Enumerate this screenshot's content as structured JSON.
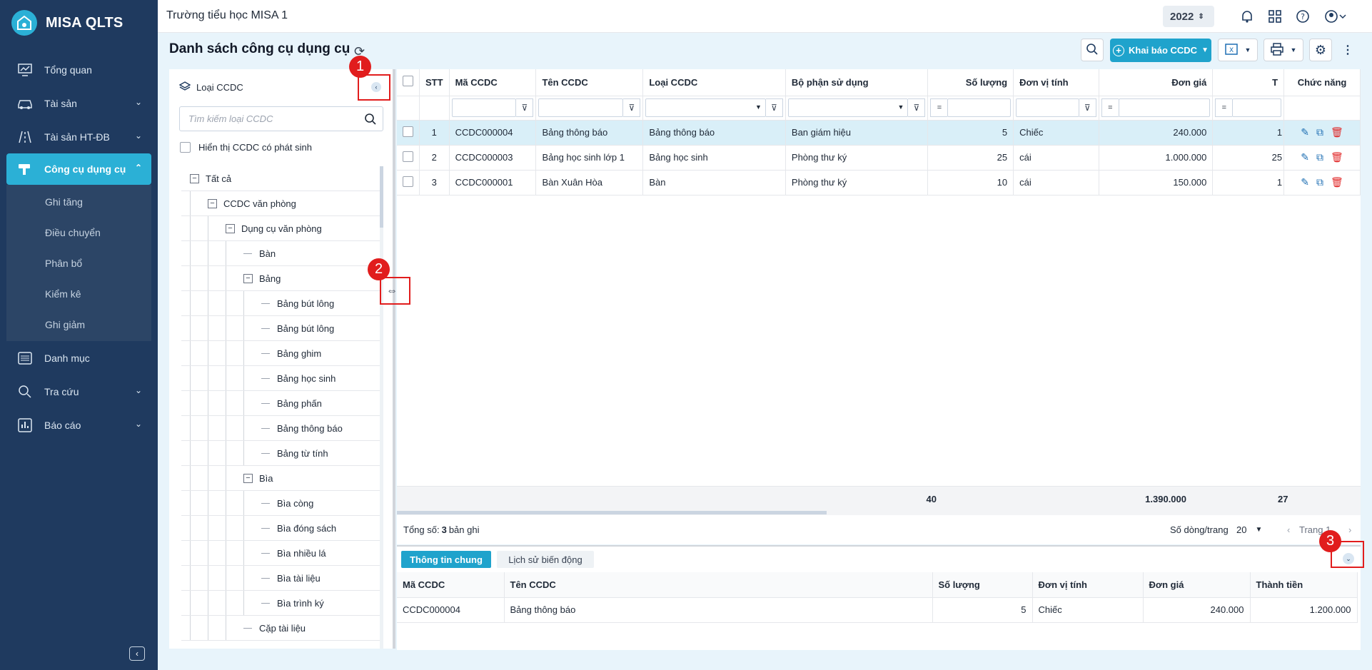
{
  "app": {
    "brand": "MISA QLTS",
    "school": "Trường tiểu học MISA 1",
    "year": "2022"
  },
  "sidebar": {
    "items": [
      {
        "label": "Tổng quan",
        "icon": "dashboard-icon"
      },
      {
        "label": "Tài sản",
        "icon": "car-icon",
        "has_chevron": true
      },
      {
        "label": "Tài sản HT-ĐB",
        "icon": "road-icon",
        "has_chevron": true
      },
      {
        "label": "Công cụ dụng cụ",
        "icon": "tools-icon",
        "has_chevron": true,
        "active": true
      },
      {
        "label": "Danh mục",
        "icon": "list-icon"
      },
      {
        "label": "Tra cứu",
        "icon": "search-icon",
        "has_chevron": true
      },
      {
        "label": "Báo cáo",
        "icon": "chart-icon",
        "has_chevron": true
      }
    ],
    "submenu": [
      "Ghi tăng",
      "Điều chuyển",
      "Phân bổ",
      "Kiểm kê",
      "Ghi giảm"
    ]
  },
  "page": {
    "title": "Danh sách công cụ dụng cụ",
    "add_button": "Khai báo CCDC"
  },
  "tree": {
    "title": "Loại CCDC",
    "search_placeholder": "Tìm kiếm loại CCDC",
    "show_arising": "Hiển thị CCDC có phát sinh",
    "nodes": [
      {
        "label": "Tất cả",
        "level": 0,
        "toggle": "⊟"
      },
      {
        "label": "CCDC văn phòng",
        "level": 1,
        "toggle": "⊟"
      },
      {
        "label": "Dụng cụ văn phòng",
        "level": 2,
        "toggle": "⊟"
      },
      {
        "label": "Bàn",
        "level": 3
      },
      {
        "label": "Bảng",
        "level": 3,
        "toggle": "⊟"
      },
      {
        "label": "Bảng bút lông",
        "level": 4
      },
      {
        "label": "Bảng bút lông",
        "level": 4
      },
      {
        "label": "Bảng ghim",
        "level": 4
      },
      {
        "label": "Bảng học sinh",
        "level": 4
      },
      {
        "label": "Bảng phấn",
        "level": 4
      },
      {
        "label": "Bảng thông báo",
        "level": 4
      },
      {
        "label": "Bảng từ tính",
        "level": 4
      },
      {
        "label": "Bìa",
        "level": 3,
        "toggle": "⊟"
      },
      {
        "label": "Bìa còng",
        "level": 4
      },
      {
        "label": "Bìa đóng sách",
        "level": 4
      },
      {
        "label": "Bìa nhiều lá",
        "level": 4
      },
      {
        "label": "Bìa tài liệu",
        "level": 4
      },
      {
        "label": "Bìa trình ký",
        "level": 4
      },
      {
        "label": "Cặp tài liệu",
        "level": 3
      }
    ]
  },
  "grid": {
    "columns": [
      "STT",
      "Mã CCDC",
      "Tên CCDC",
      "Loại CCDC",
      "Bộ phận sử dụng",
      "Số lượng",
      "Đơn vị tính",
      "Đơn giá",
      "T",
      "Chức năng"
    ],
    "filter_eq": "=",
    "rows": [
      {
        "stt": "1",
        "code": "CCDC000004",
        "name": "Bảng thông báo",
        "type": "Bảng thông báo",
        "dept": "Ban giám hiệu",
        "qty": "5",
        "unit": "Chiếc",
        "price": "240.000",
        "total": "1",
        "selected": true
      },
      {
        "stt": "2",
        "code": "CCDC000003",
        "name": "Bảng học sinh lớp 1",
        "type": "Bảng học sinh",
        "dept": "Phòng thư ký",
        "qty": "25",
        "unit": "cái",
        "price": "1.000.000",
        "total": "25"
      },
      {
        "stt": "3",
        "code": "CCDC000001",
        "name": "Bàn Xuân Hòa",
        "type": "Bàn",
        "dept": "Phòng thư ký",
        "qty": "10",
        "unit": "cái",
        "price": "150.000",
        "total": "1"
      }
    ],
    "totals": {
      "qty": "40",
      "price": "1.390.000",
      "total": "27"
    },
    "summary_prefix": "Tổng số: ",
    "summary_count": "3",
    "summary_suffix": " bản ghi",
    "rows_per_page_label": "Số dòng/trang",
    "rows_per_page": "20",
    "page_label": "Trang 1"
  },
  "detail": {
    "tabs": [
      "Thông tin chung",
      "Lịch sử biến động"
    ],
    "columns": [
      "Mã CCDC",
      "Tên CCDC",
      "Số lượng",
      "Đơn vị tính",
      "Đơn giá",
      "Thành tiền"
    ],
    "row": {
      "code": "CCDC000004",
      "name": "Bảng thông báo",
      "qty": "5",
      "unit": "Chiếc",
      "price": "240.000",
      "total": "1.200.000"
    }
  },
  "callouts": [
    "1",
    "2",
    "3"
  ],
  "colors": {
    "sidebar": "#1f3a5f",
    "accent": "#2bb0d6",
    "highlight_row": "#d9eff8",
    "callout": "#e11d1d"
  }
}
